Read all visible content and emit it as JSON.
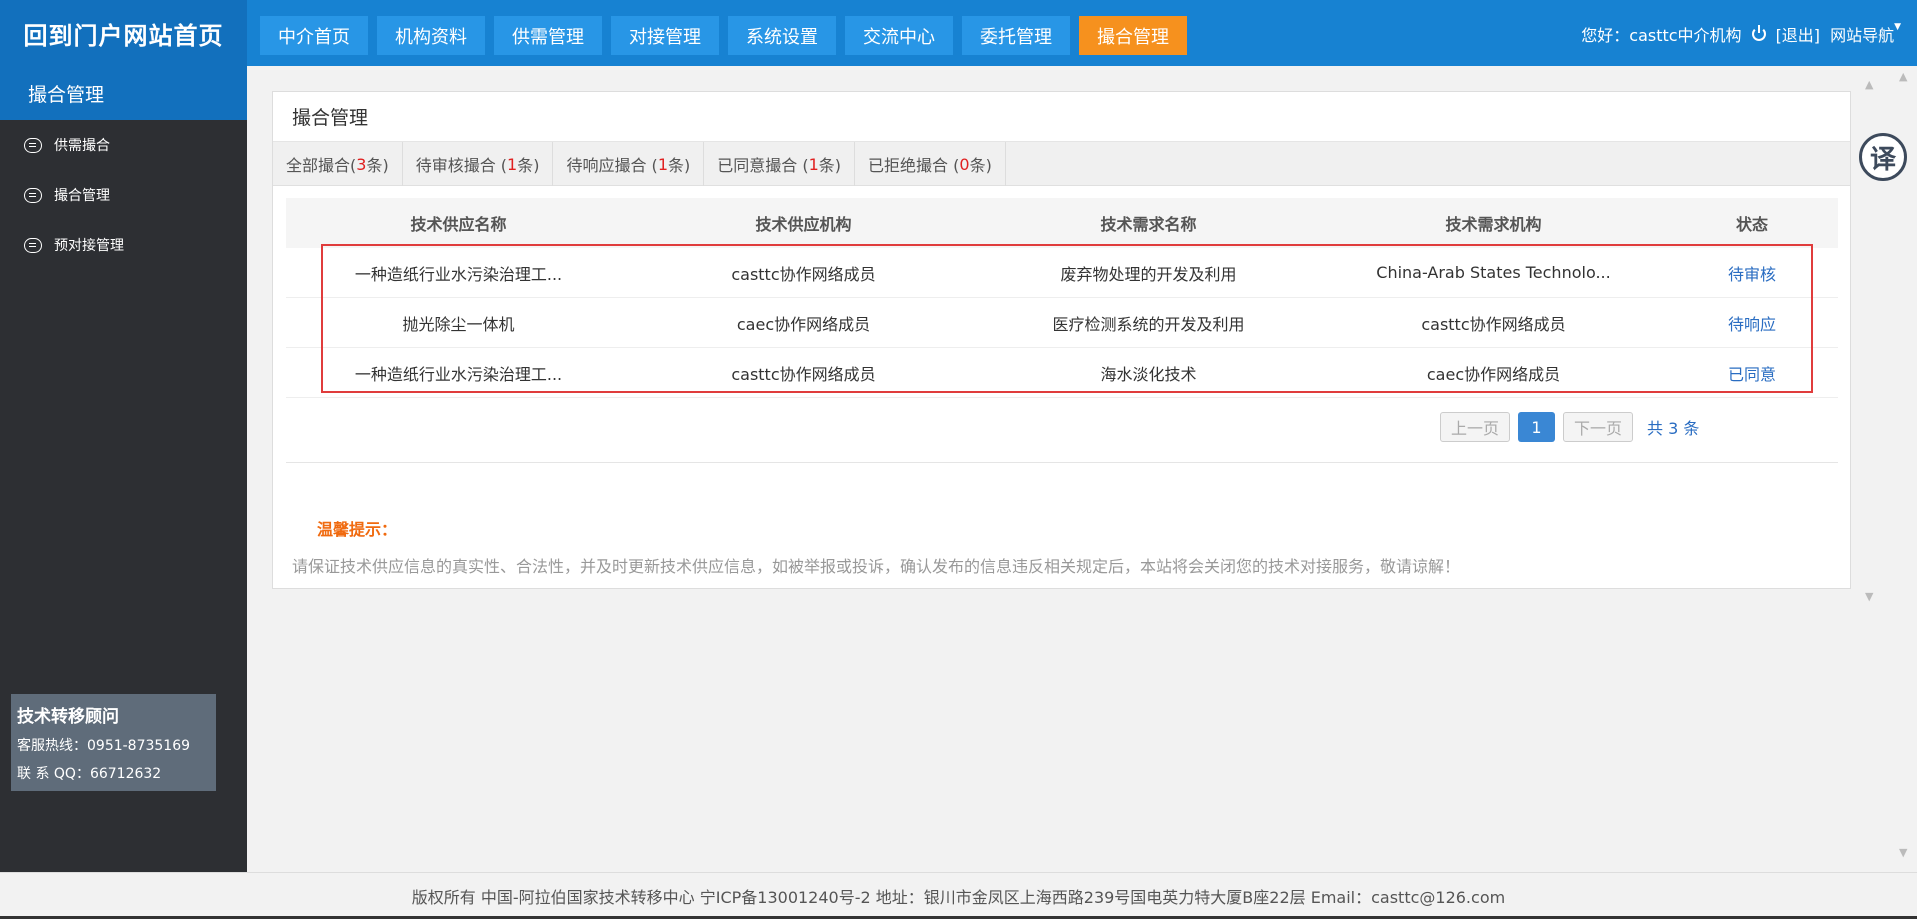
{
  "header": {
    "logo": "回到门户网站首页",
    "nav": [
      "中介首页",
      "机构资料",
      "供需管理",
      "对接管理",
      "系统设置",
      "交流中心",
      "委托管理",
      "撮合管理"
    ],
    "greeting": "您好：casttc中介机构",
    "logout": "[退出]",
    "site_nav": "网站导航"
  },
  "sidebar": {
    "title": "撮合管理",
    "items": [
      "供需撮合",
      "撮合管理",
      "预对接管理"
    ],
    "advisor": {
      "title": "技术转移顾问",
      "hotline": "客服热线：0951-8735169",
      "qq": "联 系 QQ：66712632"
    }
  },
  "panel": {
    "title": "撮合管理",
    "tabs": [
      {
        "label": "全部撮合(",
        "count": "3",
        "suffix": " 条)"
      },
      {
        "label": "待审核撮合 (",
        "count": "1",
        "suffix": " 条)"
      },
      {
        "label": "待响应撮合 (",
        "count": "1",
        "suffix": " 条)"
      },
      {
        "label": "已同意撮合 (",
        "count": "1",
        "suffix": " 条)"
      },
      {
        "label": "已拒绝撮合 (",
        "count": "0",
        "suffix": "条)"
      }
    ],
    "columns": [
      "技术供应名称",
      "技术供应机构",
      "技术需求名称",
      "技术需求机构",
      "状态"
    ],
    "rows": [
      [
        "一种造纸行业水污染治理工...",
        "casttc协作网络成员",
        "废弃物处理的开发及利用",
        "China-Arab States Technolo...",
        "待审核"
      ],
      [
        "抛光除尘一体机",
        "caec协作网络成员",
        "医疗检测系统的开发及利用",
        "casttc协作网络成员",
        "待响应"
      ],
      [
        "一种造纸行业水污染治理工...",
        "casttc协作网络成员",
        "海水淡化技术",
        "caec协作网络成员",
        "已同意"
      ]
    ],
    "pager": {
      "prev": "上一页",
      "current": "1",
      "next": "下一页",
      "total": "共 3 条"
    },
    "tip_title": "温馨提示：",
    "tip_text": "请保证技术供应信息的真实性、合法性，并及时更新技术供应信息，如被举报或投诉，确认发布的信息违反相关规定后，本站将会关闭您的技术对接服务，敬请谅解！"
  },
  "translate": "译",
  "footer": "版权所有 中国-阿拉伯国家技术转移中心 宁ICP备13001240号-2    地址：银川市金凤区上海西路239号国电英力特大厦B座22层 Email：casttc@126.com",
  "colors": {
    "primary": "#1782d2",
    "active_tab": "#f6911e",
    "sidebar": "#2d2f33",
    "highlight": "#e03c3c"
  }
}
